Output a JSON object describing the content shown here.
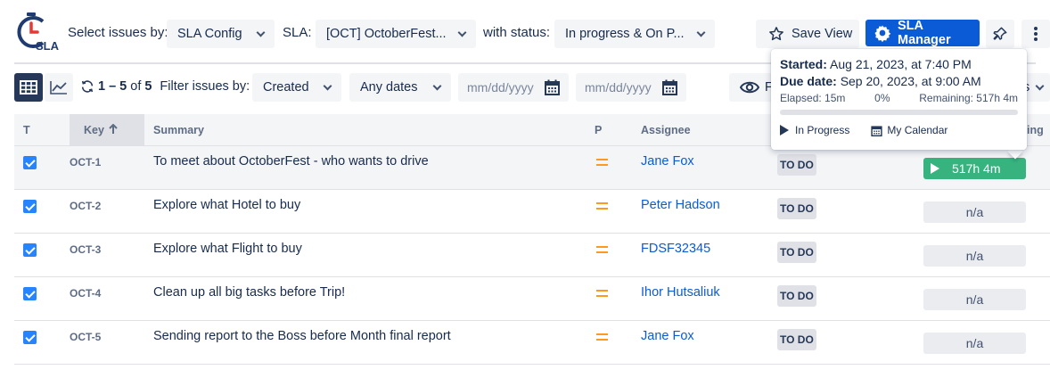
{
  "header": {
    "logo_text": "SLA",
    "select_issues_label": "Select issues by:",
    "sla_config_value": "SLA Config",
    "sla_label": "SLA:",
    "sla_value": "[OCT] OctoberFest...",
    "with_status_label": "with status:",
    "status_value": "In progress & On P...",
    "save_view_label": "Save View",
    "sla_manager_label": "SLA Manager"
  },
  "filter": {
    "range": "1 – 5",
    "of_label": "of",
    "total": "5",
    "filter_label": "Filter issues by:",
    "created_value": "Created",
    "dates_value": "Any dates",
    "date_from_placeholder": "mm/dd/yyyy",
    "date_to_placeholder": "mm/dd/yyyy",
    "eye_btn_label": "F",
    "right_dd_label": "s"
  },
  "table": {
    "columns": {
      "t": "T",
      "key": "Key",
      "summary": "Summary",
      "p": "P",
      "assignee": "Assignee",
      "remaining": "ing"
    },
    "rows": [
      {
        "key": "OCT-1",
        "summary": "To meet about OctoberFest - who wants to drive",
        "assignee": "Jane Fox",
        "status": "TO DO",
        "sla": "517h 4m"
      },
      {
        "key": "OCT-2",
        "summary": "Explore what Hotel to buy",
        "assignee": "Peter Hadson",
        "status": "TO DO",
        "sla": "n/a"
      },
      {
        "key": "OCT-3",
        "summary": "Explore what Flight to buy",
        "assignee": "FDSF32345",
        "status": "TO DO",
        "sla": "n/a"
      },
      {
        "key": "OCT-4",
        "summary": "Clean up all big tasks before Trip!",
        "assignee": "Ihor Hutsaliuk",
        "status": "TO DO",
        "sla": "n/a"
      },
      {
        "key": "OCT-5",
        "summary": "Sending report to the Boss before Month final report",
        "assignee": "Jane Fox",
        "status": "TO DO",
        "sla": "n/a"
      }
    ]
  },
  "popup": {
    "started_label": "Started:",
    "started_value": "Aug 21, 2023, at 7:40 PM",
    "due_label": "Due date:",
    "due_value": "Sep 20, 2023, at 9:00 AM",
    "elapsed": "Elapsed: 15m",
    "percent": "0%",
    "progress_fraction": 0,
    "remaining": "Remaining: 517h 4m",
    "in_progress_label": "In Progress",
    "calendar_label": "My Calendar"
  },
  "colors": {
    "primary": "#0b5bd7",
    "success": "#36b37e",
    "priority_medium": "#ff991f",
    "checkbox": "#2684ff"
  },
  "icons": {
    "logo": "stopwatch-icon",
    "save": "star-icon",
    "sla_manager": "gear-icon",
    "pin": "pin-icon",
    "more": "more-vertical-icon",
    "table_view": "table-grid-icon",
    "chart_view": "line-chart-icon",
    "refresh": "refresh-icon",
    "calendar": "calendar-icon",
    "eye": "eye-icon",
    "sort": "arrow-up-icon",
    "priority": "priority-medium-icon",
    "play": "play-icon"
  }
}
